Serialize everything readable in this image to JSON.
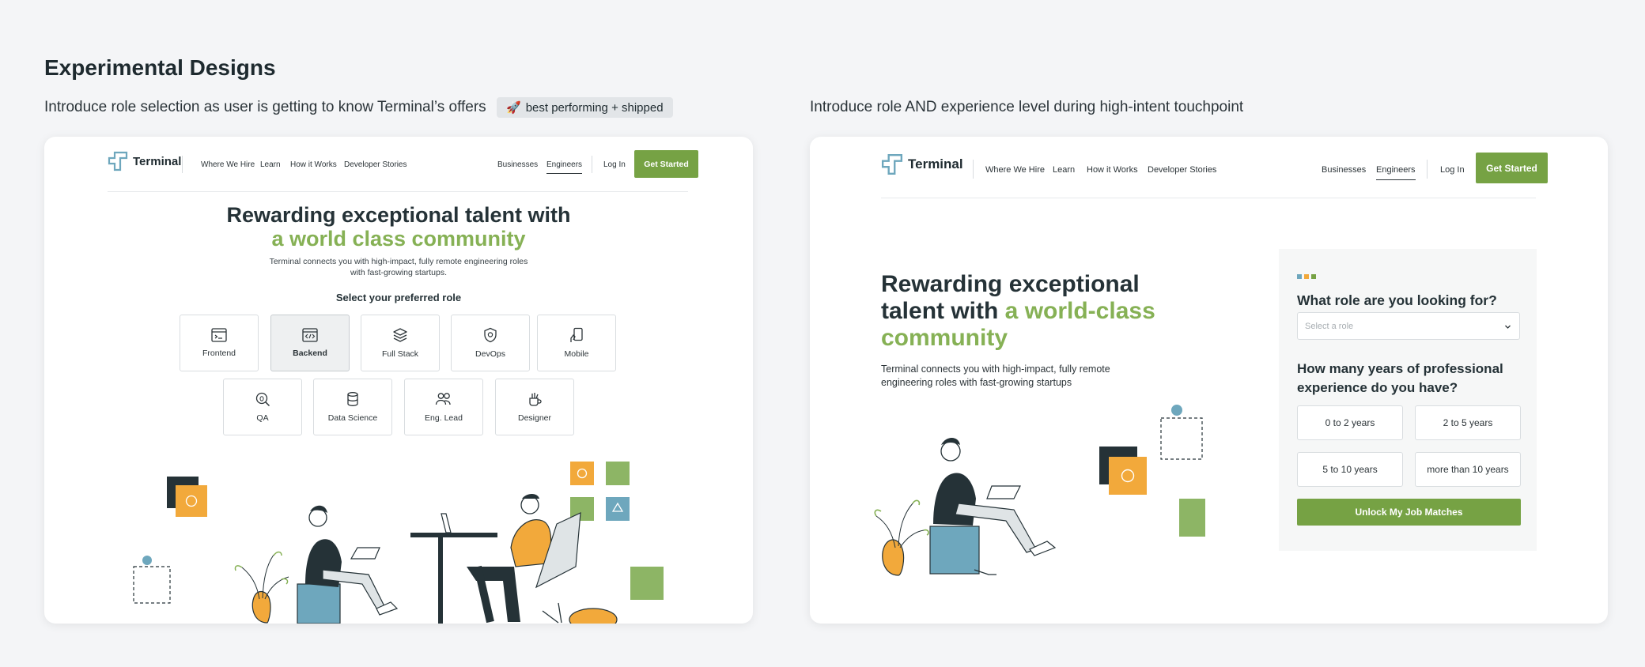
{
  "page": {
    "title": "Experimental Designs",
    "left_caption": "Introduce role selection as user is getting to know Terminal’s offers",
    "badge": {
      "emoji": "🚀",
      "text": "best performing + shipped"
    },
    "right_caption": "Introduce role AND experience level during high-intent touchpoint"
  },
  "nav": {
    "brand": "Terminal",
    "links": [
      "Where We Hire",
      "Learn",
      "How it Works",
      "Developer Stories"
    ],
    "right_links": [
      "Businesses",
      "Engineers",
      "Log In"
    ],
    "cta": "Get Started"
  },
  "left": {
    "headline_1": "Rewarding exceptional talent with",
    "headline_2": "a world class community",
    "subtext_1": "Terminal connects you with high-impact, fully remote engineering roles",
    "subtext_2": "with fast-growing startups.",
    "select_label": "Select your preferred role",
    "roles_row1": [
      {
        "label": "Frontend",
        "icon": "terminal-window-icon"
      },
      {
        "label": "Backend",
        "icon": "code-window-icon"
      },
      {
        "label": "Full Stack",
        "icon": "layers-icon"
      },
      {
        "label": "DevOps",
        "icon": "shield-gear-icon"
      },
      {
        "label": "Mobile",
        "icon": "phone-hand-icon"
      }
    ],
    "roles_row2": [
      {
        "label": "QA",
        "icon": "magnify-bug-icon"
      },
      {
        "label": "Data Science",
        "icon": "database-icon"
      },
      {
        "label": "Eng. Lead",
        "icon": "people-icon"
      },
      {
        "label": "Designer",
        "icon": "brush-cup-icon"
      }
    ],
    "active_role": "Backend"
  },
  "right": {
    "headline_1": "Rewarding exceptional",
    "headline_2a": "talent with ",
    "headline_2b": "a world-class",
    "headline_3": "community",
    "subtext_1": "Terminal connects you with high-impact, fully remote",
    "subtext_2": "engineering roles with fast-growing startups",
    "form": {
      "role_question": "What role are you looking for?",
      "role_placeholder": "Select a role",
      "experience_question_1": "How many years of professional",
      "experience_question_2": "experience do you have?",
      "options": [
        "0 to 2 years",
        "2 to 5 years",
        "5 to 10 years",
        "more than 10 years"
      ],
      "submit": "Unlock My Job Matches"
    }
  },
  "colors": {
    "brand_green": "#76a244",
    "accent_green": "#86b155",
    "orange": "#f2a93b",
    "teal": "#6ea7bd",
    "dark": "#253237"
  }
}
